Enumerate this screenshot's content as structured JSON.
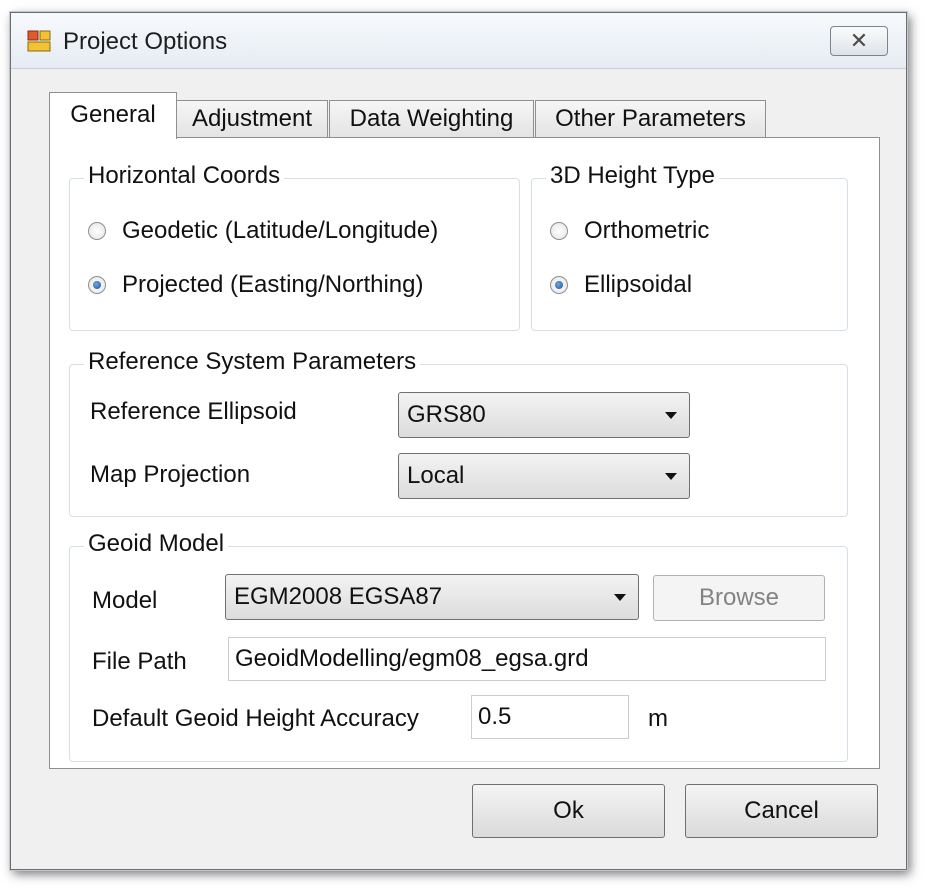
{
  "window": {
    "title": "Project Options",
    "close_glyph": "✕"
  },
  "tabs": [
    {
      "label": "General",
      "active": true
    },
    {
      "label": "Adjustment",
      "active": false
    },
    {
      "label": "Data Weighting",
      "active": false
    },
    {
      "label": "Other Parameters",
      "active": false
    }
  ],
  "horizontal_coords": {
    "title": "Horizontal Coords",
    "options": [
      {
        "label": "Geodetic (Latitude/Longitude)",
        "checked": false
      },
      {
        "label": "Projected (Easting/Northing)",
        "checked": true
      }
    ]
  },
  "height_type": {
    "title": "3D Height Type",
    "options": [
      {
        "label": "Orthometric",
        "checked": false
      },
      {
        "label": "Ellipsoidal",
        "checked": true
      }
    ]
  },
  "reference_system": {
    "title": "Reference System Parameters",
    "ellipsoid_label": "Reference Ellipsoid",
    "ellipsoid_value": "GRS80",
    "projection_label": "Map Projection",
    "projection_value": "Local"
  },
  "geoid_model": {
    "title": "Geoid Model",
    "model_label": "Model",
    "model_value": "EGM2008 EGSA87",
    "browse_label": "Browse",
    "filepath_label": "File Path",
    "filepath_value": "GeoidModelling/egm08_egsa.grd",
    "accuracy_label": "Default Geoid Height Accuracy",
    "accuracy_value": "0.5",
    "accuracy_unit": "m"
  },
  "footer": {
    "ok_label": "Ok",
    "cancel_label": "Cancel"
  },
  "colors": {
    "dialog_bg": "#f0f0f0",
    "radio_dot": "#1e4f8f",
    "disabled_text": "#838383"
  }
}
